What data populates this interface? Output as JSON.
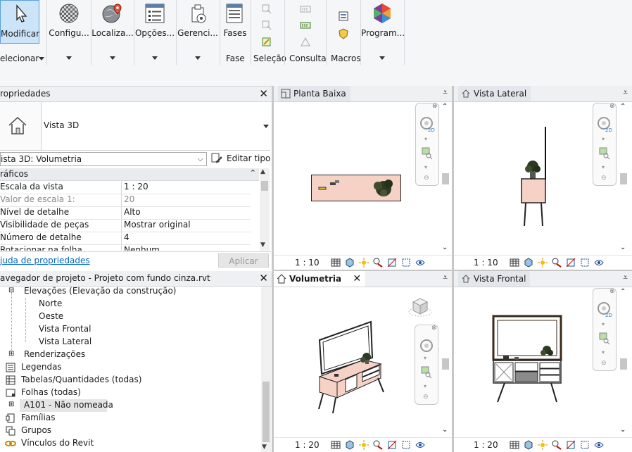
{
  "ribbon": {
    "buttons": [
      {
        "label": "Modificar",
        "icon": "cursor-icon"
      },
      {
        "label": "Configu...",
        "icon": "material-sphere-icon"
      },
      {
        "label": "Localiza...",
        "icon": "location-globe-icon"
      },
      {
        "label": "Opções...",
        "icon": "options-list-icon"
      },
      {
        "label": "Gerenci...",
        "icon": "manage-icon"
      },
      {
        "label": "Fases",
        "icon": "phases-icon"
      },
      {
        "label": "Program...",
        "icon": "dynamo-icon"
      }
    ],
    "groups": {
      "selecionar": "elecionar",
      "fase": "Fase",
      "selecao": "Seleção",
      "consulta": "Consulta",
      "macros": "Macros"
    }
  },
  "properties": {
    "title": "ropriedades",
    "type_name": "Vista 3D",
    "instance_selector": "ista 3D: Volumetria",
    "edit_type": "Editar tipo",
    "section": "ráficos",
    "rows": [
      {
        "key": "Escala da vista",
        "value": "1 : 20",
        "muted": false
      },
      {
        "key": "Valor de escala    1:",
        "value": "20",
        "muted": true
      },
      {
        "key": "Nível de detalhe",
        "value": "Alto",
        "muted": false
      },
      {
        "key": "Visibilidade de peças",
        "value": "Mostrar original",
        "muted": false
      },
      {
        "key": "Número de detalhe",
        "value": "4",
        "muted": false
      },
      {
        "key": "Rotacionar na folha",
        "value": "Nenhum",
        "muted": false
      }
    ],
    "help_link": "juda de propriedades",
    "apply": "Aplicar"
  },
  "browser": {
    "title": "avegador de projeto - Projeto com fundo cinza.rvt",
    "items": [
      {
        "label": "Elevações (Elevação da construção)",
        "kind": "node"
      },
      {
        "label": "Norte",
        "kind": "leaf"
      },
      {
        "label": "Oeste",
        "kind": "leaf"
      },
      {
        "label": "Vista Frontal",
        "kind": "leaf"
      },
      {
        "label": "Vista Lateral",
        "kind": "leaf"
      },
      {
        "label": "Renderizações",
        "kind": "node"
      },
      {
        "label": "Legendas",
        "kind": "root"
      },
      {
        "label": "Tabelas/Quantidades (todas)",
        "kind": "root"
      },
      {
        "label": "Folhas (todas)",
        "kind": "root"
      },
      {
        "label": "A101 - Não nomeada",
        "kind": "sheet"
      },
      {
        "label": "Famílias",
        "kind": "root"
      },
      {
        "label": "Grupos",
        "kind": "root"
      },
      {
        "label": "Vínculos do Revit",
        "kind": "root"
      }
    ]
  },
  "viewports": [
    {
      "title": "Planta Baixa",
      "scale": "1 : 10",
      "active": false
    },
    {
      "title": "Vista Lateral",
      "scale": "1 : 10",
      "active": false
    },
    {
      "title": "Volumetria",
      "scale": "1 : 20",
      "active": true
    },
    {
      "title": "Vista Frontal",
      "scale": "1 : 20",
      "active": false
    }
  ],
  "colors": {
    "furniture": "#f6d1c6",
    "accent": "#0067c0",
    "ribbon_bg": "#f5f6f7",
    "active_button": "#cce4f7"
  }
}
